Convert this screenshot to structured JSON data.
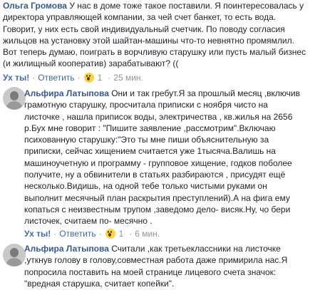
{
  "comments": [
    {
      "author": "Ольга Громова",
      "lines": [
        " У нас в доме тоже такое поставили. Я поинтересовалась у",
        "директора управляющей компании, за чей счет банкет, то есть вода.",
        "Говорит, у них есть свой индивидуальный счетчик. По поводу согласия",
        "жильцов на установку этой шайтан-машины что-то невнятно промямлил.",
        "Вот теперь думаю, поиграть в ворчливую старушку или пусть малый бизнес",
        "(и жилищный кооператив) зарабатывают? (("
      ],
      "actions": {
        "like": "Ух ты!",
        "reply": "Ответить",
        "reaction_icon": "wow-reaction-icon",
        "reaction_count": "1",
        "time": "25 мин."
      }
    },
    {
      "author": "Альфира Латыпова",
      "lines": [
        " Они и так гребут.Я за прошлый месяц ,включив",
        "грамотную старушку, просчитала приписки с ноября чисто на",
        "листочке , нашла приписок воды, электричества , кв.жилья на 2656",
        "р.Бух мне говорит : \"Пишите заявление ,рассмотрим\".Включаю",
        "психованную старушку:\"Это ты мне пиши объяснительную за",
        "приписки, сейчас хищением считается уже 1тысяча.Валишь на",
        "машиноучетную и программу - групповое хищение, годков поболее",
        "получите, ну а обвинители в статьях разбираются , присудят ещё",
        "несколько.Видишь, на одной тебе только чистыми руками он",
        "выполнит месячный план раскрытия преступлений).А на фига ему",
        "копаться с неизвестным трупом ,заведомо дело- висяк.Ну, чо бери",
        "листочек, считаем по- месячно ."
      ],
      "actions": {
        "like": "Ух ты!",
        "reply": "Ответить",
        "reaction_icon": "wow-reaction-icon",
        "reaction_count": "1",
        "time": "6 мин."
      }
    },
    {
      "author": "Альфира Латыпова",
      "lines": [
        " Считали ,как третьеклассники на листочке",
        ",уткнув голову в голову,совместная работа даже примирила нас.Я",
        "попросила поставить на моей странице лицевого счета значок:",
        "\"вредная старушка, считает копейки\"."
      ]
    }
  ],
  "separator": "·"
}
